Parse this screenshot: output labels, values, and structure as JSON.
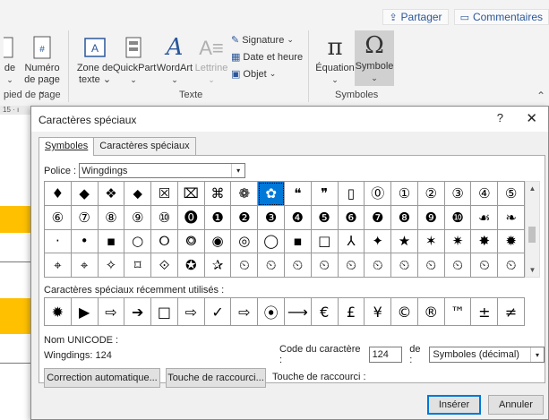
{
  "ribbon": {
    "share": "Partager",
    "comments": "Commentaires",
    "items": {
      "de": "de",
      "de_sub": "⌄",
      "numero": "Numéro",
      "numero_sub": "de page ⌄",
      "zone": "Zone de",
      "zone_sub": "texte ⌄",
      "quickpart": "QuickPart",
      "quickpart_sub": "⌄",
      "wordart": "WordArt",
      "wordart_sub": "⌄",
      "lettrine": "Lettrine",
      "lettrine_sub": "⌄",
      "signature": "Signature",
      "date": "Date et heure",
      "objet": "Objet",
      "equation": "Équation",
      "equation_sub": "⌄",
      "symbole": "Symbole",
      "symbole_sub": "⌄"
    },
    "groups": {
      "page": "pied de page",
      "texte": "Texte",
      "symboles": "Symboles"
    }
  },
  "document": {
    "ruler": "15 · ı"
  },
  "dialog": {
    "title": "Caractères spéciaux",
    "help": "?",
    "close": "✕",
    "tabs": [
      "Symboles",
      "Caractères spéciaux"
    ],
    "font_label": "Police :",
    "font_value": "Wingdings",
    "symbols": [
      "♦",
      "◆",
      "❖",
      "⬥",
      "☒",
      "⌧",
      "⌘",
      "❁",
      "❁",
      "❝",
      "❞",
      "▯",
      "⓪",
      "①",
      "②",
      "③",
      "④",
      "⑤",
      "⑥",
      "⑦",
      "⑧",
      "⑨",
      "⑩",
      "⓿",
      "❶",
      "❷",
      "❸",
      "❹",
      "❺",
      "❻",
      "❼",
      "❽",
      "❾",
      "❿",
      "☙",
      "❧",
      "☙",
      "❧",
      "☙",
      "❦",
      "❦",
      "❦",
      "·",
      "•",
      "▪",
      "○",
      "⭘",
      "⭗",
      "◉",
      "◎",
      "◯",
      "▪",
      "□",
      "⅄",
      "✦",
      "★",
      "✶",
      "✷",
      "✸",
      "✹",
      "⌖",
      "⌖",
      "✧",
      "⌑",
      "⟐",
      "✪",
      "✰",
      "⏲",
      "⏲",
      "⏲",
      "⏲",
      "⏲",
      "⏲",
      "⏲",
      "⏲",
      "⏲",
      "⏲",
      "⏲",
      "⮰",
      "⮱",
      "⮲",
      "⮳"
    ],
    "grid_symbols": [
      "♦",
      "◆",
      "❖",
      "⬥",
      "☒",
      "⌧",
      "⌘",
      "❁",
      "✿",
      "❝",
      "❞",
      "▯",
      "⓪",
      "①",
      "②",
      "③",
      "④",
      "⑤",
      "⑥",
      "⑦",
      "⑧",
      "⑨",
      "⑩",
      "⓿",
      "❶",
      "❷",
      "❸",
      "❹",
      "❺",
      "❻",
      "❼",
      "❽",
      "❾",
      "❿",
      "☙",
      "❧",
      "·",
      "•",
      "▪",
      "○",
      "⭘",
      "⭗",
      "◉",
      "◎",
      "◯",
      "▪",
      "□",
      "⅄",
      "✦",
      "★",
      "✶",
      "✷",
      "✸",
      "✹",
      "⌖",
      "⌖",
      "✧",
      "⌑",
      "⟐",
      "✪",
      "✰",
      "⏲",
      "⏲",
      "⏲",
      "⏲",
      "⏲",
      "⏲",
      "⏲",
      "⏲",
      "⏲",
      "⏲",
      "⏲"
    ],
    "selected_index": 8,
    "recent_label": "Caractères spéciaux récemment utilisés :",
    "recent_symbols": [
      "✹",
      "▶",
      "⇨",
      "➔",
      "□",
      "⇨",
      "✓",
      "⇨",
      "⦿",
      "⟶",
      "€",
      "£",
      "¥",
      "©",
      "®",
      "™",
      "±",
      "≠",
      "≤",
      "≥",
      "÷"
    ],
    "unicode_label": "Nom UNICODE :",
    "char_name": "Wingdings: 124",
    "code_label": "Code du caractère :",
    "code_value": "124",
    "de_label": "de :",
    "de_value": "Symboles (décimal)",
    "autocorrect": "Correction automatique...",
    "shortcut_key": "Touche de raccourci...",
    "shortcut_label": "Touche de raccourci :",
    "insert": "Insérer",
    "cancel": "Annuler"
  }
}
